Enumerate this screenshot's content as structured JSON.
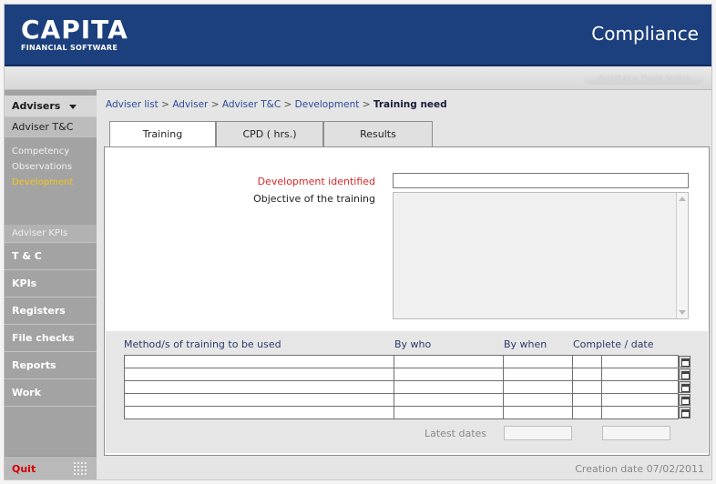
{
  "header": {
    "logo_main": "CAPITA",
    "logo_sub": "FINANCIAL SOFTWARE",
    "app_title": "Compliance",
    "brand_color": "#1c3f7e"
  },
  "toolbar": {
    "ghost_text": "Anastasia Paula Jenkis"
  },
  "sidebar": {
    "advisers_label": "Advisers",
    "adviser_tc_label": "Adviser T&C",
    "sub_items": [
      {
        "label": "Competency",
        "active": false
      },
      {
        "label": "Observations",
        "active": false
      },
      {
        "label": "Development",
        "active": true
      }
    ],
    "adviser_kpis_label": "Adviser KPIs",
    "items": [
      {
        "label": "T & C"
      },
      {
        "label": "KPIs"
      },
      {
        "label": "Registers"
      },
      {
        "label": "File checks"
      },
      {
        "label": "Reports"
      },
      {
        "label": "Work"
      }
    ],
    "quit_label": "Quit"
  },
  "breadcrumb": {
    "items": [
      "Adviser list",
      "Adviser",
      "Adviser T&C",
      "Development"
    ],
    "separator": ">",
    "current": "Training need"
  },
  "tabs": [
    {
      "label": "Training",
      "active": true
    },
    {
      "label": "CPD ( hrs.)",
      "active": false
    },
    {
      "label": "Results",
      "active": false
    }
  ],
  "form": {
    "development_identified_label": "Development identified",
    "development_identified_value": "",
    "objective_label": "Objective of the training",
    "objective_value": ""
  },
  "methods_table": {
    "headers": {
      "method": "Method/s of training to be used",
      "by_who": "By who",
      "by_when": "By when",
      "complete": "Complete / date"
    },
    "rows": [
      {
        "method": "",
        "by_who": "",
        "by_when": "",
        "complete": "",
        "date": ""
      },
      {
        "method": "",
        "by_who": "",
        "by_when": "",
        "complete": "",
        "date": ""
      },
      {
        "method": "",
        "by_who": "",
        "by_when": "",
        "complete": "",
        "date": ""
      },
      {
        "method": "",
        "by_who": "",
        "by_when": "",
        "complete": "",
        "date": ""
      },
      {
        "method": "",
        "by_who": "",
        "by_when": "",
        "complete": "",
        "date": ""
      }
    ],
    "latest_dates_label": "Latest dates"
  },
  "footer": {
    "creation_date": "Creation date 07/02/2011"
  },
  "colors": {
    "required_label": "#d62828",
    "active_subitem": "#f5c518",
    "quit": "#d40000",
    "link": "#2a4a9a"
  }
}
